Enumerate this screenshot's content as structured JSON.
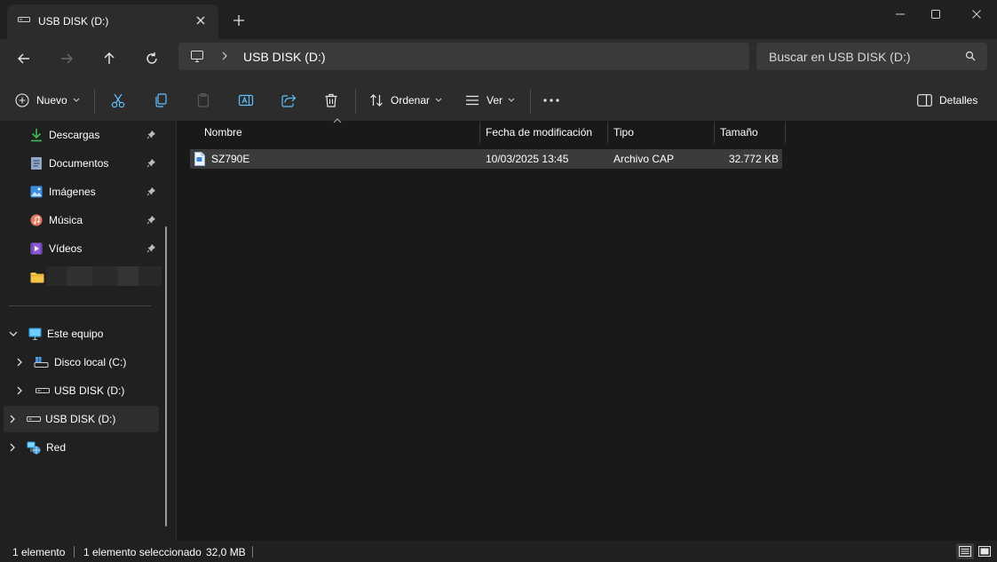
{
  "window": {
    "tab_title": "USB DISK (D:)",
    "controls": [
      "minimize",
      "maximize",
      "close"
    ]
  },
  "address_bar": {
    "path": "USB DISK (D:)",
    "search_placeholder": "Buscar en USB DISK (D:)"
  },
  "toolbar": {
    "new_label": "Nuevo",
    "sort_label": "Ordenar",
    "view_label": "Ver",
    "details_label": "Detalles",
    "icons": [
      "cut-icon",
      "copy-icon",
      "paste-icon",
      "rename-icon",
      "share-icon",
      "delete-icon",
      "more-icon"
    ]
  },
  "sidebar": {
    "quick_access": [
      {
        "label": "Descargas",
        "icon": "download-icon",
        "color": "#3fb950"
      },
      {
        "label": "Documentos",
        "icon": "document-icon",
        "color": "#8fa7c8"
      },
      {
        "label": "Imágenes",
        "icon": "pictures-icon",
        "color": "#3c8fe0"
      },
      {
        "label": "Música",
        "icon": "music-icon",
        "color": "#e07a5f"
      },
      {
        "label": "Vídeos",
        "icon": "videos-icon",
        "color": "#8e5bd6"
      }
    ],
    "tree": {
      "this_pc": "Este equipo",
      "local_disk": "Disco local (C:)",
      "usb_child": "USB DISK (D:)",
      "usb_root": "USB DISK (D:)",
      "network": "Red"
    }
  },
  "columns": {
    "name": "Nombre",
    "modified": "Fecha de modificación",
    "type": "Tipo",
    "size": "Tamaño"
  },
  "files": [
    {
      "name": "SZ790E",
      "modified": "10/03/2025 13:45",
      "type": "Archivo CAP",
      "size": "32.772 KB"
    }
  ],
  "status": {
    "count": "1 elemento",
    "selected": "1 elemento seleccionado",
    "selected_size": "32,0 MB"
  },
  "colors": {
    "background": "#191919",
    "panel": "#2c2c2c",
    "selection": "#3b3b3b",
    "accent": "#4cc2ff"
  }
}
